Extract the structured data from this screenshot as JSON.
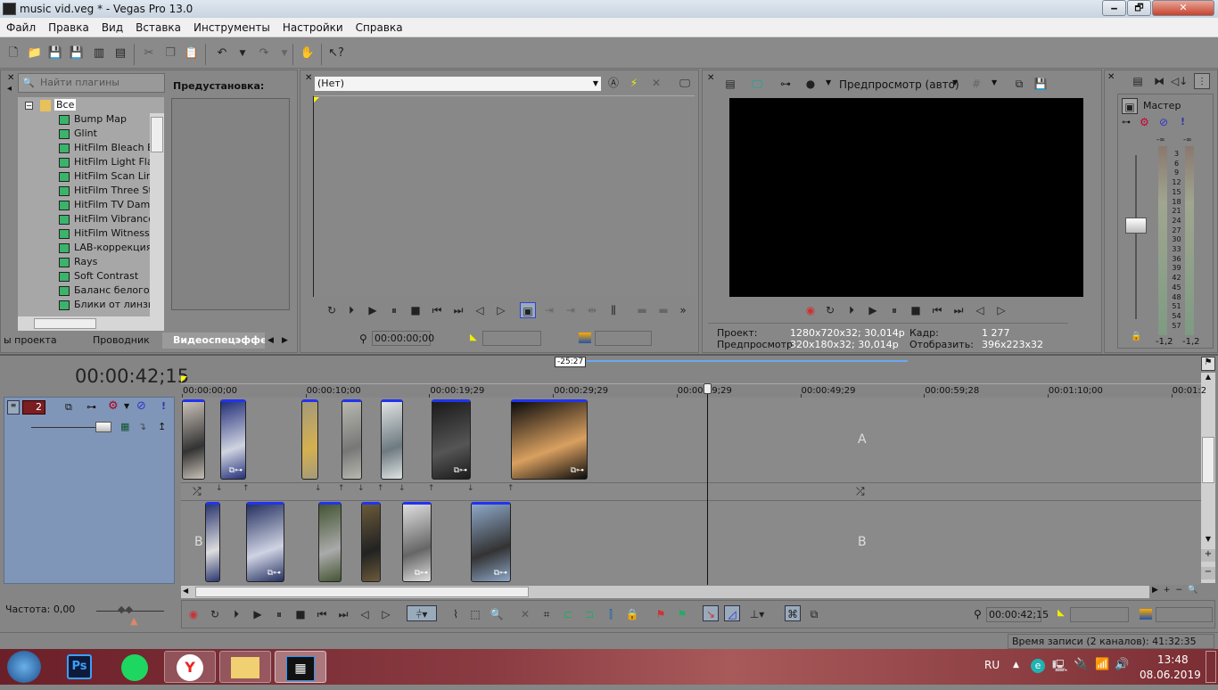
{
  "window": {
    "title": "music vid.veg * - Vegas Pro 13.0",
    "minimize": "🗕",
    "maximize": "🗗",
    "close": "✕"
  },
  "menu": [
    "Файл",
    "Правка",
    "Вид",
    "Вставка",
    "Инструменты",
    "Настройки",
    "Справка"
  ],
  "toolbar": {
    "icons": [
      "new-icon",
      "open-icon",
      "save-icon",
      "save-as-icon",
      "render-icon",
      "properties-icon",
      "cut-icon",
      "copy-icon",
      "paste-icon",
      "undo-icon",
      "redo-icon",
      "enable-snapping-icon",
      "whats-this-icon"
    ]
  },
  "plugins": {
    "search_placeholder": "Найти плагины",
    "preset_label": "Предустановка:",
    "root": "Все",
    "items": [
      "Bump Map",
      "Glint",
      "HitFilm Bleach Byp",
      "HitFilm Light Flares",
      "HitFilm Scan Lines",
      "HitFilm Three Strip",
      "HitFilm TV Damage",
      "HitFilm Vibrance",
      "HitFilm Witness Pr",
      "LAB-коррекция",
      "Rays",
      "Soft Contrast",
      "Баланс белого",
      "Блики от линзы"
    ],
    "tabs": [
      "ы проекта",
      "Проводник",
      "Видеоспецэффе"
    ]
  },
  "trimmer": {
    "dropdown": "(Нет)",
    "timecode": "00:00:00;00"
  },
  "preview": {
    "mode": "Предпросмотр (авто)",
    "info": {
      "project_label": "Проект:",
      "project_value": "1280x720x32; 30,014p",
      "preview_label": "Предпросмотр:",
      "preview_value": "320x180x32; 30,014p",
      "frame_label": "Кадр:",
      "frame_value": "1 277",
      "display_label": "Отобразить:",
      "display_value": "396x223x32"
    }
  },
  "mixer": {
    "master_label": "Мастер",
    "scale": [
      "-∞",
      "3",
      "6",
      "9",
      "12",
      "15",
      "18",
      "21",
      "24",
      "27",
      "30",
      "33",
      "36",
      "39",
      "42",
      "45",
      "48",
      "51",
      "54",
      "57"
    ],
    "left_peak": "-1,2",
    "right_peak": "-1,2",
    "top_left": "-∞",
    "top_right": "-∞"
  },
  "timeline": {
    "timecode": "00:00:42;15",
    "loop_region": "-25:27",
    "ruler": [
      "00:00:00;00",
      "00:00:10;00",
      "00:00:19;29",
      "00:00:29;29",
      "00:00:39;29",
      "00:00:49;29",
      "00:00:59;28",
      "00:01:10;00",
      "00:01:2"
    ],
    "track": {
      "number": "2",
      "label_a": "A",
      "label_b": "B"
    },
    "rate_label": "Частота: 0,00",
    "cursor_timecode": "00:00:42;15"
  },
  "status": {
    "record_time": "Время записи (2 каналов): 41:32:35"
  },
  "taskbar": {
    "apps": [
      "Ps",
      "Spotify",
      "Yandex",
      "Explorer",
      "Vegas"
    ],
    "lang": "RU",
    "time": "13:48",
    "date": "08.06.2019"
  },
  "colors": {
    "panel": "#878787",
    "track_header": "#7f96b8",
    "clip_handle": "#2233ee",
    "cursor_flag": "#ffee00",
    "loop_bar": "#6aa8f0"
  }
}
